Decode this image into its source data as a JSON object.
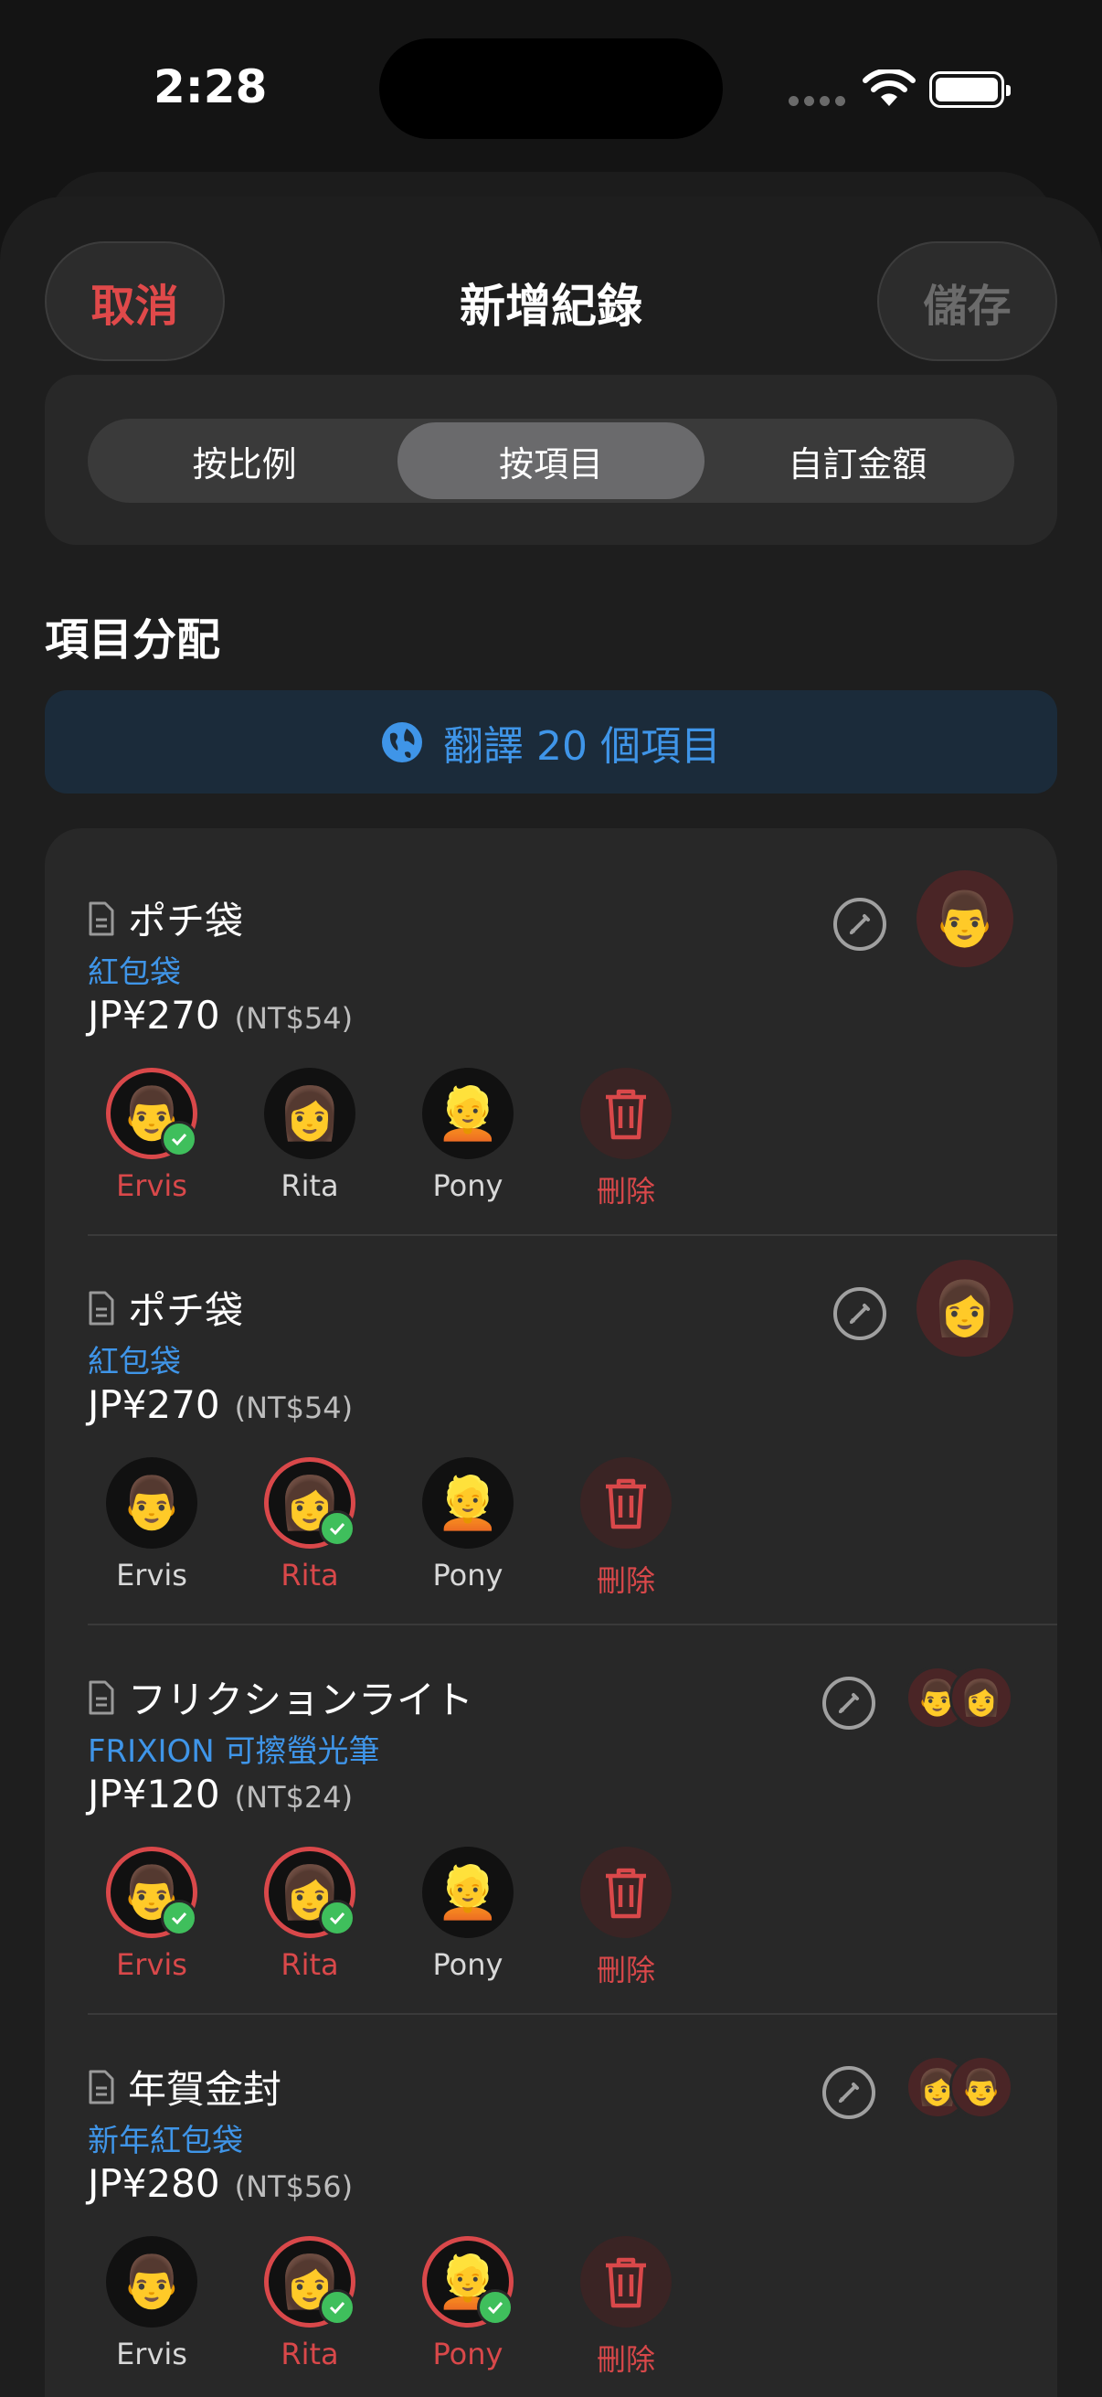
{
  "status_bar": {
    "time": "2:28"
  },
  "header": {
    "cancel_label": "取消",
    "title": "新增紀錄",
    "save_label": "儲存"
  },
  "segments": [
    {
      "label": "按比例",
      "active": false
    },
    {
      "label": "按項目",
      "active": true
    },
    {
      "label": "自訂金額",
      "active": false
    }
  ],
  "section_title": "項目分配",
  "translate_button": "翻譯 20 個項目",
  "colors": {
    "accent_red": "#d9484a",
    "accent_blue": "#3f95e8",
    "check_green": "#3fbf5c"
  },
  "items": [
    {
      "name": "ポチ袋",
      "translation": "紅包袋",
      "price": "JP¥270",
      "price_nt": "(NT$54)",
      "assigned": [
        "man-blond-emoji"
      ],
      "people": [
        {
          "label": "Ervis",
          "emoji": "👨",
          "selected": true
        },
        {
          "label": "Rita",
          "emoji": "👩",
          "selected": false
        },
        {
          "label": "Pony",
          "emoji": "👱",
          "selected": false
        },
        {
          "label": "刪除",
          "icon": "trash-icon"
        }
      ]
    },
    {
      "name": "ポチ袋",
      "translation": "紅包袋",
      "price": "JP¥270",
      "price_nt": "(NT$54)",
      "assigned": [
        "woman-blond-emoji"
      ],
      "people": [
        {
          "label": "Ervis",
          "emoji": "👨",
          "selected": false
        },
        {
          "label": "Rita",
          "emoji": "👩",
          "selected": true
        },
        {
          "label": "Pony",
          "emoji": "👱",
          "selected": false
        },
        {
          "label": "刪除",
          "icon": "trash-icon"
        }
      ]
    },
    {
      "name": "フリクションライト",
      "translation": "FRIXION 可擦螢光筆",
      "price": "JP¥120",
      "price_nt": "(NT$24)",
      "assigned": [
        "man-blond-emoji",
        "woman-blond-emoji"
      ],
      "people": [
        {
          "label": "Ervis",
          "emoji": "👨",
          "selected": true
        },
        {
          "label": "Rita",
          "emoji": "👩",
          "selected": true
        },
        {
          "label": "Pony",
          "emoji": "👱",
          "selected": false
        },
        {
          "label": "刪除",
          "icon": "trash-icon"
        }
      ]
    },
    {
      "name": "年賀金封",
      "translation": "新年紅包袋",
      "price": "JP¥280",
      "price_nt": "(NT$56)",
      "assigned": [
        "woman-blond-emoji",
        "man-blond-emoji"
      ],
      "people": [
        {
          "label": "Ervis",
          "emoji": "👨",
          "selected": false
        },
        {
          "label": "Rita",
          "emoji": "👩",
          "selected": true
        },
        {
          "label": "Pony",
          "emoji": "👱",
          "selected": true
        },
        {
          "label": "刪除",
          "icon": "trash-icon"
        }
      ]
    }
  ]
}
